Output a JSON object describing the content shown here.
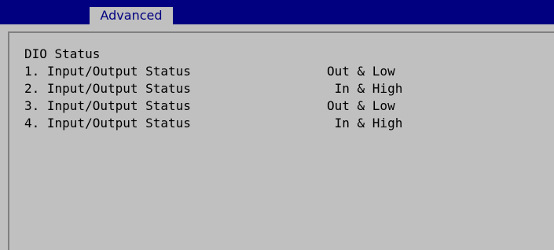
{
  "tabs": [
    {
      "label": "Advanced",
      "active": true
    }
  ],
  "section_title": "DIO Status",
  "rows": [
    {
      "label": "1. Input/Output Status",
      "value": "Out & Low"
    },
    {
      "label": "2. Input/Output Status",
      "value": " In & High"
    },
    {
      "label": "3. Input/Output Status",
      "value": "Out & Low"
    },
    {
      "label": "4. Input/Output Status",
      "value": " In & High"
    }
  ],
  "colors": {
    "title_bar": "#000080",
    "background": "#c0c0c0",
    "tab_text": "#000080",
    "text": "#000000"
  }
}
